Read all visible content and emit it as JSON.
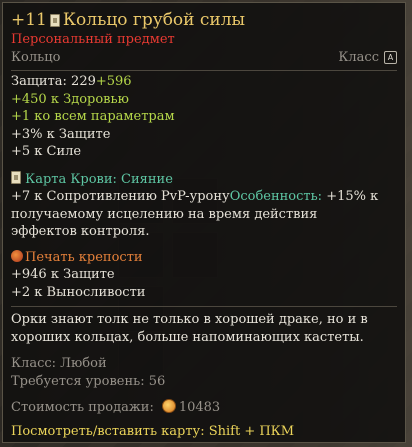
{
  "item": {
    "enhance": "+11",
    "name": "Кольцо грубой силы",
    "personal": "Персональный предмет",
    "type": "Кольцо",
    "class_label": "Класс",
    "class_key": "A"
  },
  "stats": {
    "defense_label": "Защита: 229",
    "defense_bonus": "+596",
    "health": "+450 к Здоровью",
    "all_params": "+1 ко всем параметрам",
    "defense_pct": "+3% к Защите",
    "strength": "+5 к Силе"
  },
  "blood_card": {
    "title": "Карта Крови: Сияние",
    "pvp_res": "+7 к Сопротивлению PvP-урону",
    "feature_label": "Особенность:",
    "feature_text": " +15% к",
    "feature_text_2": "получаемому исцелению на время действия эффектов контроля."
  },
  "seal": {
    "title": "Печать крепости",
    "defense": "+946 к Защите",
    "stamina": "+2 к Выносливости"
  },
  "lore": "Орки знают толк не только в хорошей драке, но и в хороших кольцах, больше напоминающих кастеты.",
  "requirements": {
    "class": "Класс: Любой",
    "level": "Требуется уровень: 56"
  },
  "sale": {
    "label": "Стоимость продажи:",
    "value": "10483"
  },
  "hint": "Посмотреть/вставить карту: Shift + ПКМ",
  "colors": {
    "title": "#eac86a",
    "personal": "#ea3a32",
    "bonus": "#b6d84a",
    "card": "#5ec7a4",
    "seal": "#e6813a",
    "hint": "#ecd55a"
  }
}
